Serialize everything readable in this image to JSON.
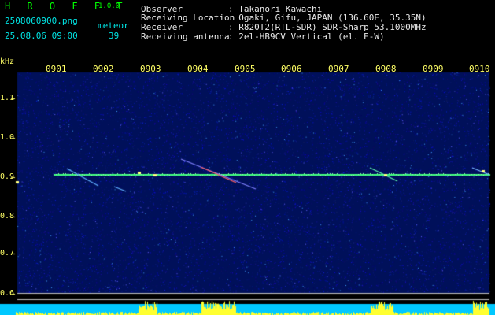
{
  "header": {
    "app_title": "H R O F F T",
    "version": "1.0.0",
    "filename": "2508060900.png",
    "datetime": "25.08.06 09:00",
    "meteor_label": "meteor",
    "meteor_count": "39"
  },
  "info": {
    "observer_label": "Observer",
    "observer_value": ": Takanori Kawachi",
    "location_label": "Receiving Location",
    "location_value": ": Ogaki, Gifu, JAPAN (136.60E, 35.35N)",
    "receiver_label": "Receiver",
    "receiver_value": ": R820T2(RTL-SDR) SDR-Sharp 53.1000MHz",
    "antenna_label": "Receiving antenna",
    "antenna_value": ": 2el-HB9CV Vertical (el. E-W)"
  },
  "axis": {
    "y_unit": "kHz",
    "y_ticks": [
      "1.1",
      "1.0",
      "0.9",
      "0.8",
      "0.7",
      "0.6"
    ],
    "x_ticks": [
      "0901",
      "0902",
      "0903",
      "0904",
      "0905",
      "0906",
      "0907",
      "0908",
      "0909",
      "0910"
    ]
  },
  "colors": {
    "background": "#000000",
    "spectrogram_bg": "#00105a",
    "carrier": "#40ff80",
    "info_text": "#e8e8e8",
    "header_cyan": "#00e5e5",
    "axis_yellow": "#ffff66",
    "title_green": "#00ff00"
  }
}
